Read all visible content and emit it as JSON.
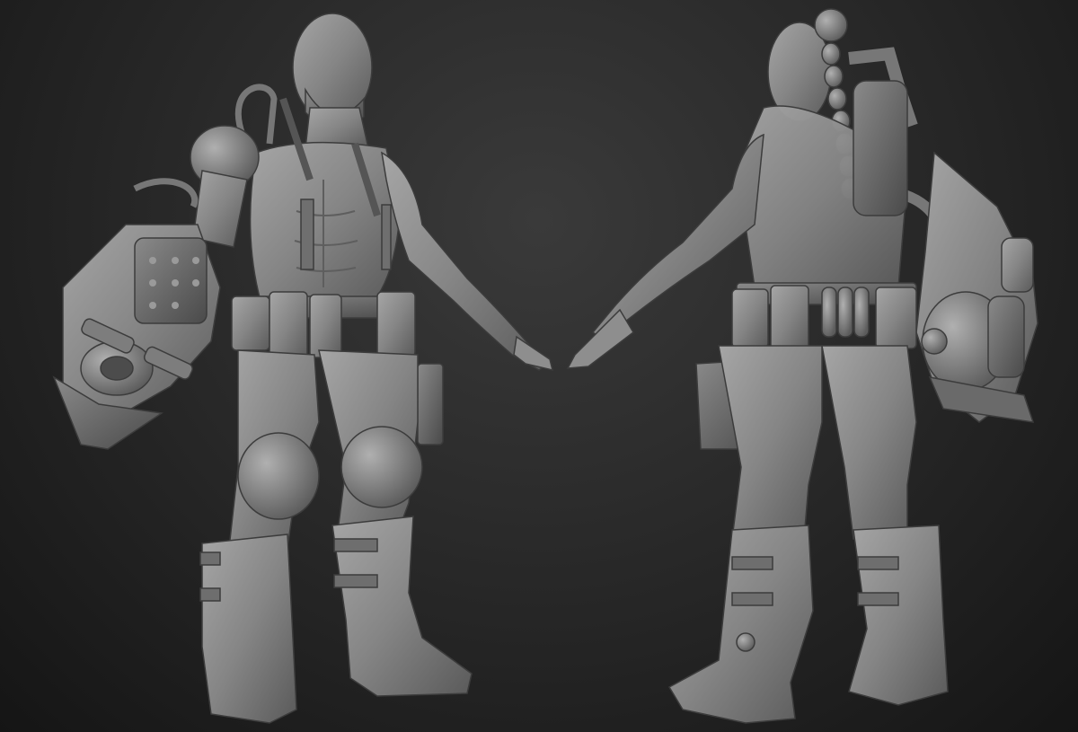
{
  "scene": {
    "background_color": "#2b2b2b",
    "material_color": "#8c8c8c",
    "views": [
      {
        "name": "front-three-quarter-view"
      },
      {
        "name": "back-three-quarter-view"
      }
    ]
  }
}
